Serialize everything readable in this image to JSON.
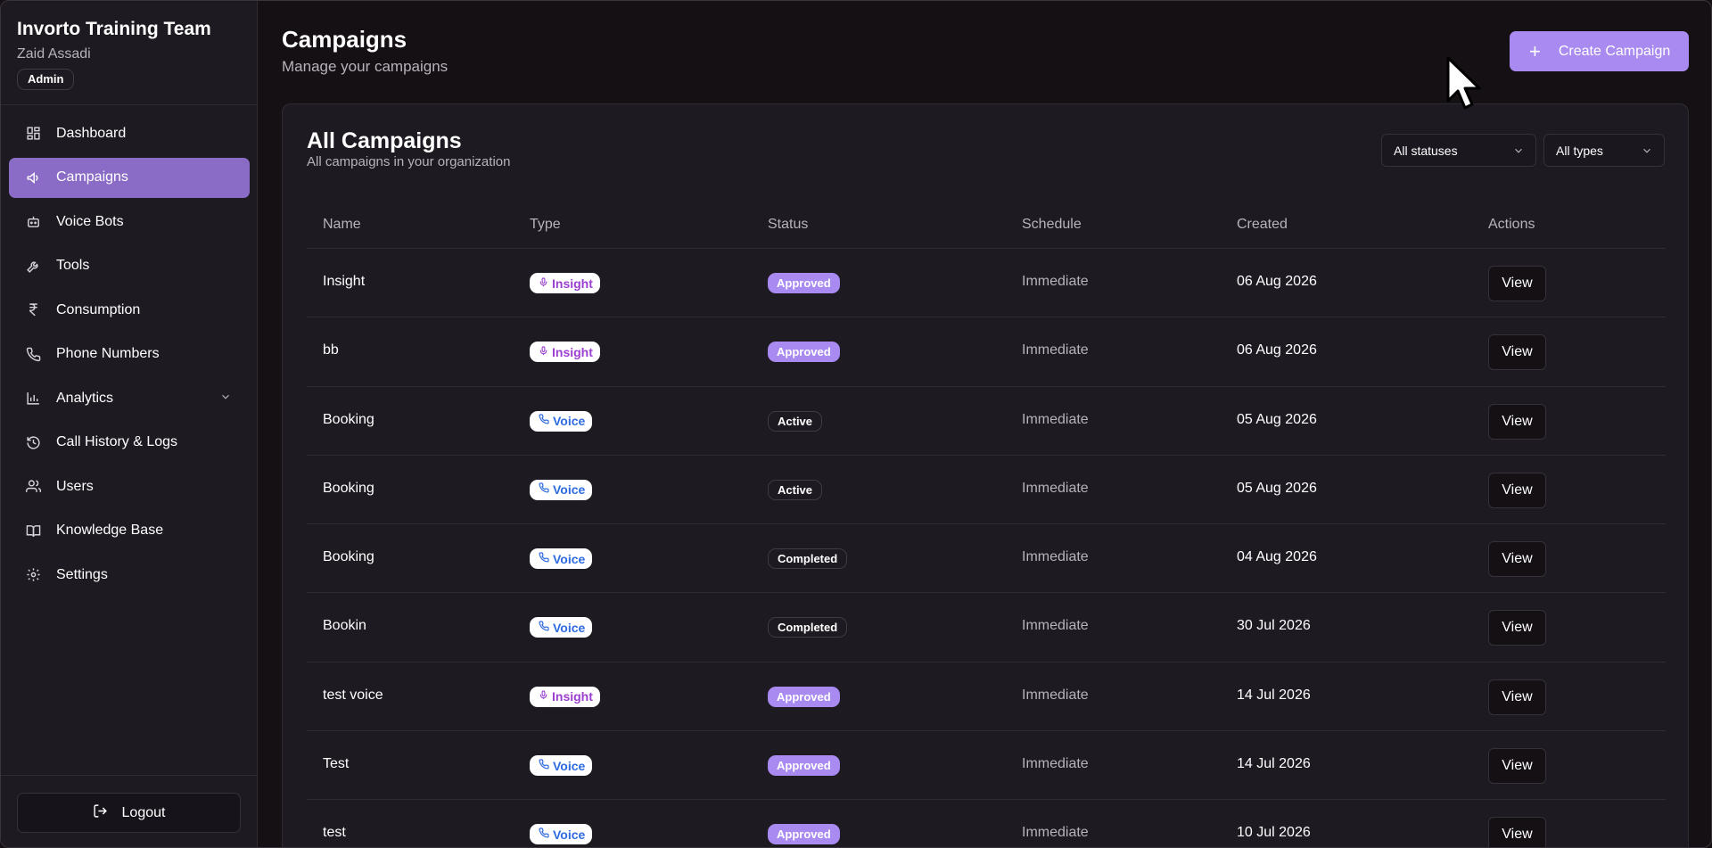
{
  "sidebar": {
    "org_name": "Invorto Training Team",
    "user_name": "Zaid Assadi",
    "role": "Admin",
    "items": [
      {
        "label": "Dashboard",
        "icon": "dashboard-icon"
      },
      {
        "label": "Campaigns",
        "icon": "megaphone-icon",
        "active": true
      },
      {
        "label": "Voice Bots",
        "icon": "bot-icon"
      },
      {
        "label": "Tools",
        "icon": "wrench-icon"
      },
      {
        "label": "Consumption",
        "icon": "rupee-icon"
      },
      {
        "label": "Phone Numbers",
        "icon": "phone-icon"
      },
      {
        "label": "Analytics",
        "icon": "bar-chart-icon",
        "expandable": true
      },
      {
        "label": "Call History & Logs",
        "icon": "history-icon"
      },
      {
        "label": "Users",
        "icon": "users-icon"
      },
      {
        "label": "Knowledge Base",
        "icon": "book-icon"
      },
      {
        "label": "Settings",
        "icon": "gear-icon"
      }
    ],
    "logout_label": "Logout"
  },
  "header": {
    "title": "Campaigns",
    "subtitle": "Manage your campaigns",
    "create_label": "Create Campaign"
  },
  "card": {
    "title": "All Campaigns",
    "subtitle": "All campaigns in your organization",
    "status_filter": "All statuses",
    "type_filter": "All types"
  },
  "table": {
    "columns": [
      "Name",
      "Type",
      "Status",
      "Schedule",
      "Created",
      "Actions"
    ],
    "view_label": "View",
    "rows": [
      {
        "name": "Insight",
        "type": "Insight",
        "status": "Approved",
        "schedule": "Immediate",
        "created": "06 Aug 2026"
      },
      {
        "name": "bb",
        "type": "Insight",
        "status": "Approved",
        "schedule": "Immediate",
        "created": "06 Aug 2026"
      },
      {
        "name": "Booking",
        "type": "Voice",
        "status": "Active",
        "schedule": "Immediate",
        "created": "05 Aug 2026"
      },
      {
        "name": "Booking",
        "type": "Voice",
        "status": "Active",
        "schedule": "Immediate",
        "created": "05 Aug 2026"
      },
      {
        "name": "Booking",
        "type": "Voice",
        "status": "Completed",
        "schedule": "Immediate",
        "created": "04 Aug 2026"
      },
      {
        "name": "Bookin",
        "type": "Voice",
        "status": "Completed",
        "schedule": "Immediate",
        "created": "30 Jul 2026"
      },
      {
        "name": "test voice",
        "type": "Insight",
        "status": "Approved",
        "schedule": "Immediate",
        "created": "14 Jul 2026"
      },
      {
        "name": "Test",
        "type": "Voice",
        "status": "Approved",
        "schedule": "Immediate",
        "created": "14 Jul 2026"
      },
      {
        "name": "test",
        "type": "Voice",
        "status": "Approved",
        "schedule": "Immediate",
        "created": "10 Jul 2026"
      }
    ]
  },
  "colors": {
    "accent": "#a98af0",
    "sidebar_active": "#8a6bc6",
    "insight": "#9b3fd0",
    "voice": "#2e6be0",
    "background": "#141013"
  }
}
